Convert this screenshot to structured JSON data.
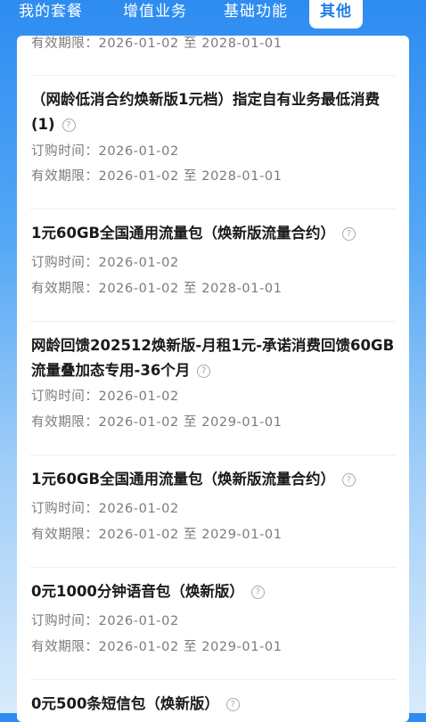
{
  "tabs": [
    {
      "label": "我的套餐"
    },
    {
      "label": "增值业务"
    },
    {
      "label": "基础功能"
    },
    {
      "label": "其他"
    }
  ],
  "partial_item": {
    "validity_label": "有效期限：",
    "validity": "2026-01-02 至 2028-01-01"
  },
  "items": [
    {
      "title": "（网龄低消合约焕新版1元档）指定自有业务最低消费(1)",
      "order_label": "订购时间：",
      "order_date": "2026-01-02",
      "validity_label": "有效期限：",
      "validity": "2026-01-02 至 2028-01-01"
    },
    {
      "title": "1元60GB全国通用流量包（焕新版流量合约）",
      "order_label": "订购时间：",
      "order_date": "2026-01-02",
      "validity_label": "有效期限：",
      "validity": "2026-01-02 至 2028-01-01"
    },
    {
      "title": "网龄回馈202512焕新版-月租1元-承诺消费回馈60GB流量叠加态专用-36个月",
      "order_label": "订购时间：",
      "order_date": "2026-01-02",
      "validity_label": "有效期限：",
      "validity": "2026-01-02 至 2029-01-01"
    },
    {
      "title": "1元60GB全国通用流量包（焕新版流量合约）",
      "order_label": "订购时间：",
      "order_date": "2026-01-02",
      "validity_label": "有效期限：",
      "validity": "2026-01-02 至 2029-01-01"
    },
    {
      "title": "0元1000分钟语音包（焕新版）",
      "order_label": "订购时间：",
      "order_date": "2026-01-02",
      "validity_label": "有效期限：",
      "validity": "2026-01-02 至 2029-01-01"
    },
    {
      "title": "0元500条短信包（焕新版）"
    }
  ],
  "help_icon": {
    "glyph": "?",
    "name": "help-circle-icon"
  },
  "colors": {
    "accent": "#1f7fe8",
    "title": "#1a1a1a",
    "meta": "#7a7a7a"
  }
}
